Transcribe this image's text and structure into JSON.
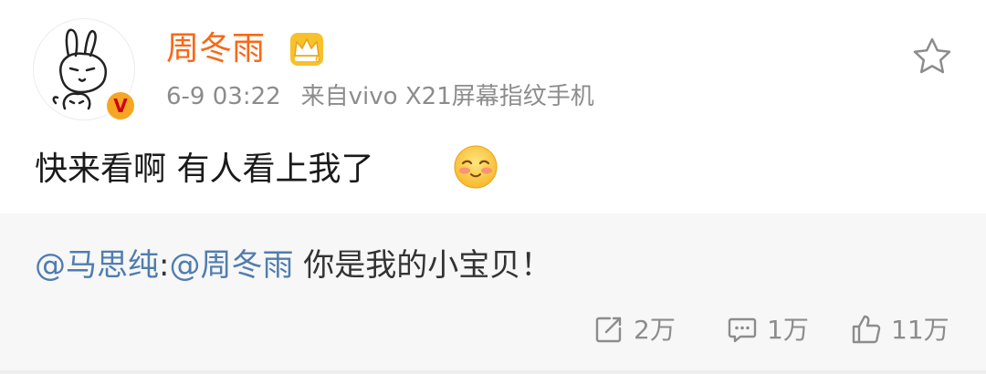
{
  "post": {
    "author": {
      "name": "周冬雨",
      "avatar_icon": "rabbit-avatar",
      "verified_badge": "V",
      "member_icon": "crown-icon"
    },
    "time": "6-9 03:22",
    "source": "来自vivo X21屏幕指纹手机",
    "text": "快来看啊 有人看上我了",
    "emoji_icon": "blush-smile-emoji"
  },
  "repost": {
    "mention_user": "@马思纯",
    "separator": ":",
    "mention_target": "@周冬雨",
    "message": " 你是我的小宝贝！"
  },
  "actions": {
    "reposts": "2万",
    "comments": "1万",
    "likes": "11万"
  },
  "colors": {
    "username": "#f86818",
    "mention": "#507daf",
    "meta": "#8c8c8c",
    "repost_bg": "#f7f7f7"
  }
}
